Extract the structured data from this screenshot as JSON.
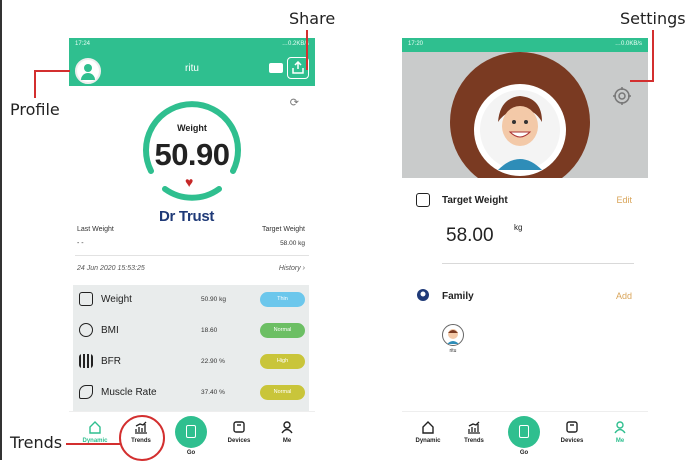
{
  "annotations": {
    "share": "Share",
    "settings": "Settings",
    "profile": "Profile",
    "trends": "Trends"
  },
  "phone1": {
    "status_time": "17:24",
    "status_right": "…0.2KB/s",
    "user_name": "ritu",
    "weight_label": "Weight",
    "weight_value": "50.90",
    "brand": "Dr Trust",
    "last_weight_label": "Last Weight",
    "last_weight_value": "- -",
    "target_weight_label": "Target Weight",
    "target_weight_value": "58.00 kg",
    "date": "24 Jun 2020 15:53:25",
    "history": "History",
    "metrics": [
      {
        "name": "Weight",
        "value": "50.90 kg",
        "badge": "Thin",
        "color": "#6cc7ec",
        "icon": "scale-icon"
      },
      {
        "name": "BMI",
        "value": "18.60",
        "badge": "Normal",
        "color": "#6cbf64",
        "icon": "bmi-icon"
      },
      {
        "name": "BFR",
        "value": "22.90 %",
        "badge": "High",
        "color": "#c9c53a",
        "icon": "bfr-icon"
      },
      {
        "name": "Muscle Rate",
        "value": "37.40 %",
        "badge": "Normal",
        "color": "#c9c53a",
        "icon": "muscle-icon"
      }
    ],
    "tabs": [
      "Dynamic",
      "Trends",
      "Go",
      "Devices",
      "Me"
    ]
  },
  "phone2": {
    "status_time": "17:20",
    "status_right": "…0.0KB/s",
    "target_weight_label": "Target Weight",
    "edit": "Edit",
    "target_value": "58.00",
    "target_unit": "kg",
    "family_label": "Family",
    "add": "Add",
    "member_name": "ritu",
    "tabs": [
      "Dynamic",
      "Trends",
      "Go",
      "Devices",
      "Me"
    ]
  },
  "colors": {
    "accent": "#2fbf8f",
    "annotation": "#d32f2f",
    "link": "#d9a55a"
  }
}
